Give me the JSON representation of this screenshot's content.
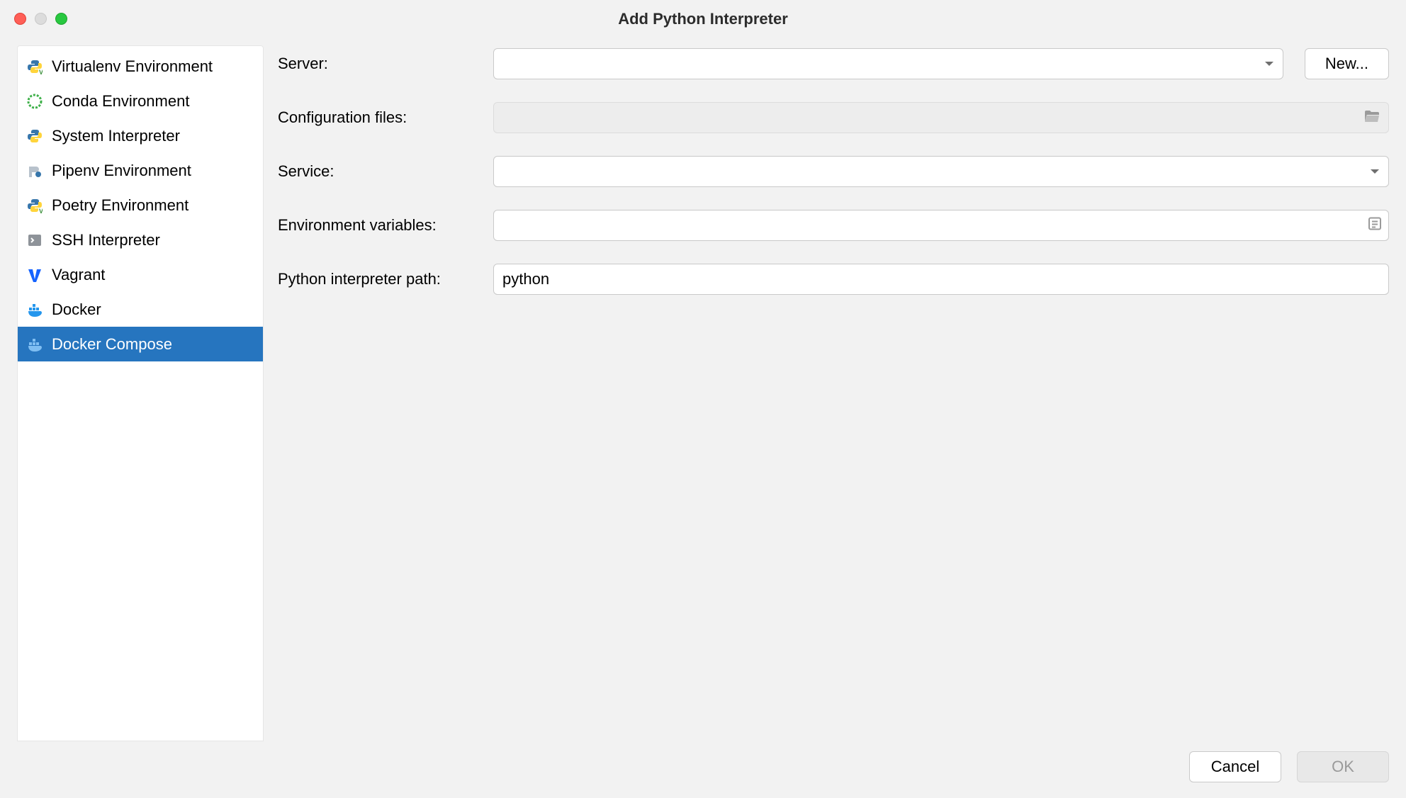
{
  "title": "Add Python Interpreter",
  "sidebar": {
    "items": [
      {
        "label": "Virtualenv Environment",
        "icon": "python-v-icon"
      },
      {
        "label": "Conda Environment",
        "icon": "conda-icon"
      },
      {
        "label": "System Interpreter",
        "icon": "python-icon"
      },
      {
        "label": "Pipenv Environment",
        "icon": "pipenv-icon"
      },
      {
        "label": "Poetry Environment",
        "icon": "python-v-icon"
      },
      {
        "label": "SSH Interpreter",
        "icon": "terminal-icon"
      },
      {
        "label": "Vagrant",
        "icon": "vagrant-icon"
      },
      {
        "label": "Docker",
        "icon": "docker-icon"
      },
      {
        "label": "Docker Compose",
        "icon": "docker-compose-icon"
      }
    ],
    "selected_index": 8
  },
  "form": {
    "server": {
      "label": "Server:",
      "value": "",
      "new_button": "New..."
    },
    "config_files": {
      "label": "Configuration files:",
      "value": ""
    },
    "service": {
      "label": "Service:",
      "value": ""
    },
    "env_vars": {
      "label": "Environment variables:",
      "value": ""
    },
    "python_path": {
      "label": "Python interpreter path:",
      "value": "python"
    }
  },
  "footer": {
    "cancel": "Cancel",
    "ok": "OK",
    "ok_enabled": false
  }
}
